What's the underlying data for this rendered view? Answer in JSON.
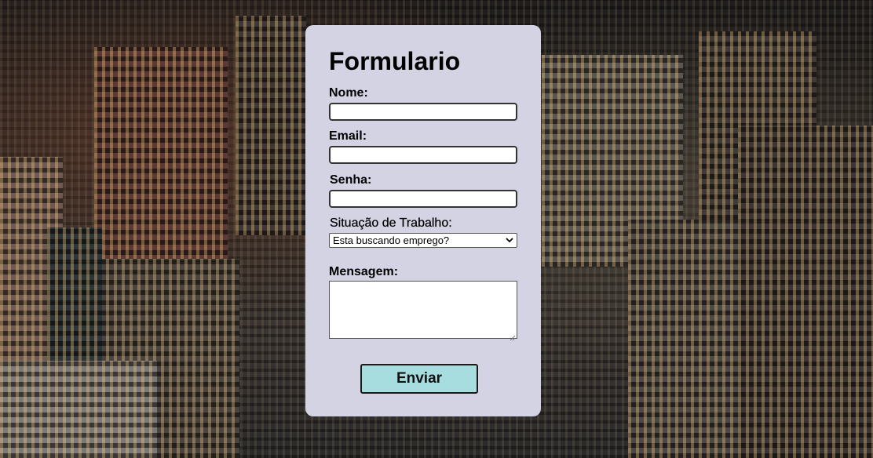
{
  "form": {
    "title": "Formulario",
    "fields": {
      "nome": {
        "label": "Nome:",
        "value": ""
      },
      "email": {
        "label": "Email:",
        "value": ""
      },
      "senha": {
        "label": "Senha:",
        "value": ""
      },
      "situacao": {
        "label": "Situação de Trabalho:",
        "selected": "Esta buscando emprego?"
      },
      "mensagem": {
        "label": "Mensagem:",
        "value": ""
      }
    },
    "submit_label": "Enviar"
  },
  "colors": {
    "card_background": "#d4d3e4",
    "button_background": "#a8dde0"
  },
  "icons": {
    "select_arrow": "chevron-down-icon",
    "textarea_resize": "resize-grip-icon"
  }
}
